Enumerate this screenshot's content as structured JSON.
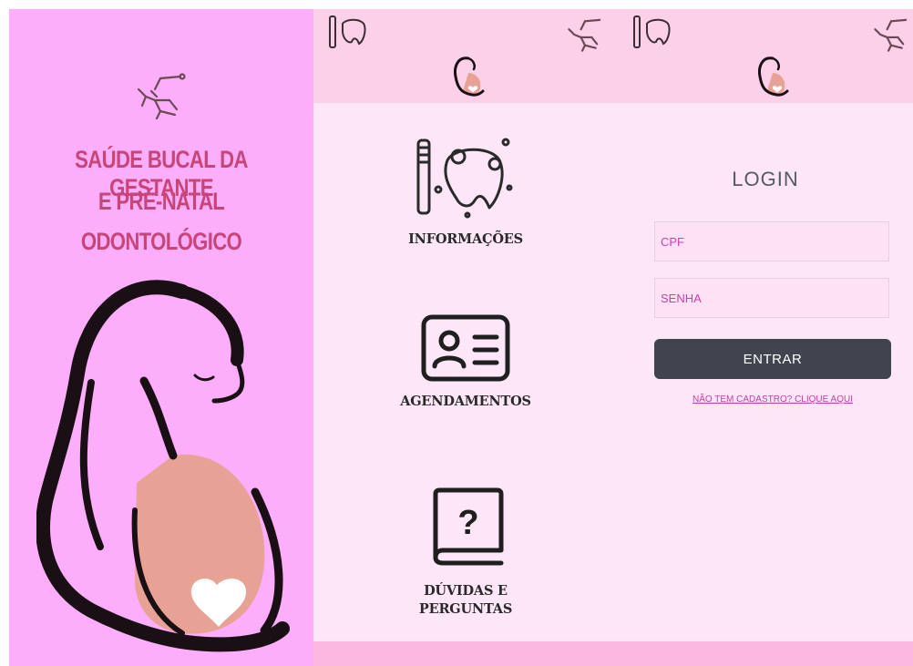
{
  "splash": {
    "title_lines": [
      "SAÚDE BUCAL DA GESTANTE",
      "E PRÉ-NATAL",
      "ODONTOLÓGICO"
    ]
  },
  "menu": {
    "items": [
      {
        "label_lines": [
          "INFORMAÇÕES"
        ],
        "icon": "tooth-toothbrush-icon"
      },
      {
        "label_lines": [
          "AGENDAMENTOS"
        ],
        "icon": "id-card-icon"
      },
      {
        "label_lines": [
          "DÚVIDAS E",
          "PERGUNTAS"
        ],
        "icon": "question-book-icon"
      }
    ]
  },
  "login": {
    "title": "LOGIN",
    "cpf_placeholder": "CPF",
    "password_placeholder": "SENHA",
    "submit_label": "ENTRAR",
    "signup_link": "NÃO TEM CADASTRO? CLIQUE AQUI"
  },
  "colors": {
    "splash_bg": "#fcaefa",
    "title_text": "#c8457a",
    "header_bg": "#fdd0ea",
    "panel_bg": "#fde6f8",
    "button_bg": "#3f444e",
    "field_text": "#cc3fae"
  },
  "icons": [
    "dental-chair-icon",
    "pregnant-woman-icon",
    "tooth-toothbrush-icon",
    "id-card-icon",
    "question-book-icon",
    "heart-icon"
  ]
}
